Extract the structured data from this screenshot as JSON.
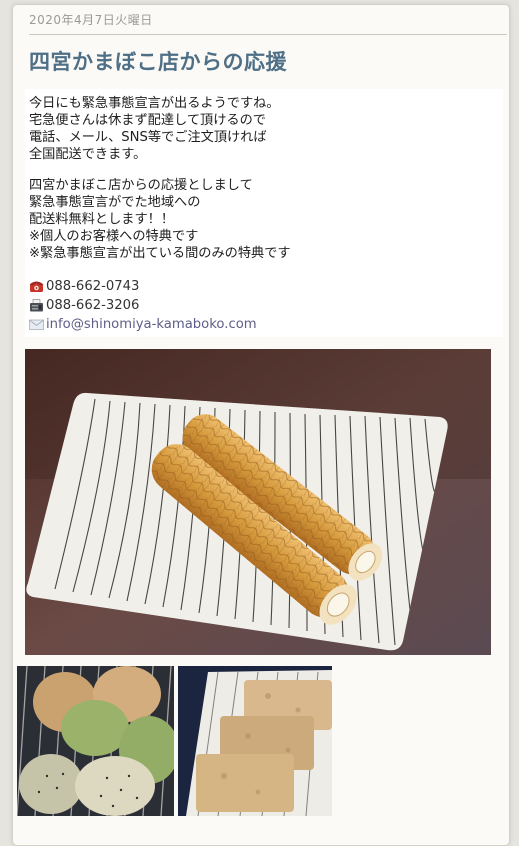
{
  "post": {
    "date": "2020年4月7日火曜日",
    "title": "四宮かまぼこ店からの応援",
    "paragraph1": [
      "今日にも緊急事態宣言が出るようですね。",
      "宅急便さんは休まず配達して頂けるので",
      "電話、メール、SNS等でご注文頂ければ",
      "全国配送できます。"
    ],
    "paragraph2": [
      "四宮かまぼこ店からの応援としまして",
      "緊急事態宣言がでた地域への",
      "配送料無料とします！！",
      "※個人のお客様への特典です",
      "※緊急事態宣言が出ている間のみの特典です"
    ],
    "contacts": {
      "phone": "088-662-0743",
      "fax": "088-662-3206",
      "email": "info@shinomiya-kamaboko.com"
    }
  },
  "icons": {
    "phone": "telephone-icon",
    "fax": "fax-icon",
    "email": "envelope-icon"
  },
  "colors": {
    "title": "#4f6f86",
    "date": "#9a9a96",
    "card_background": "#fbfaf6",
    "page_background": "#e6e4de"
  }
}
